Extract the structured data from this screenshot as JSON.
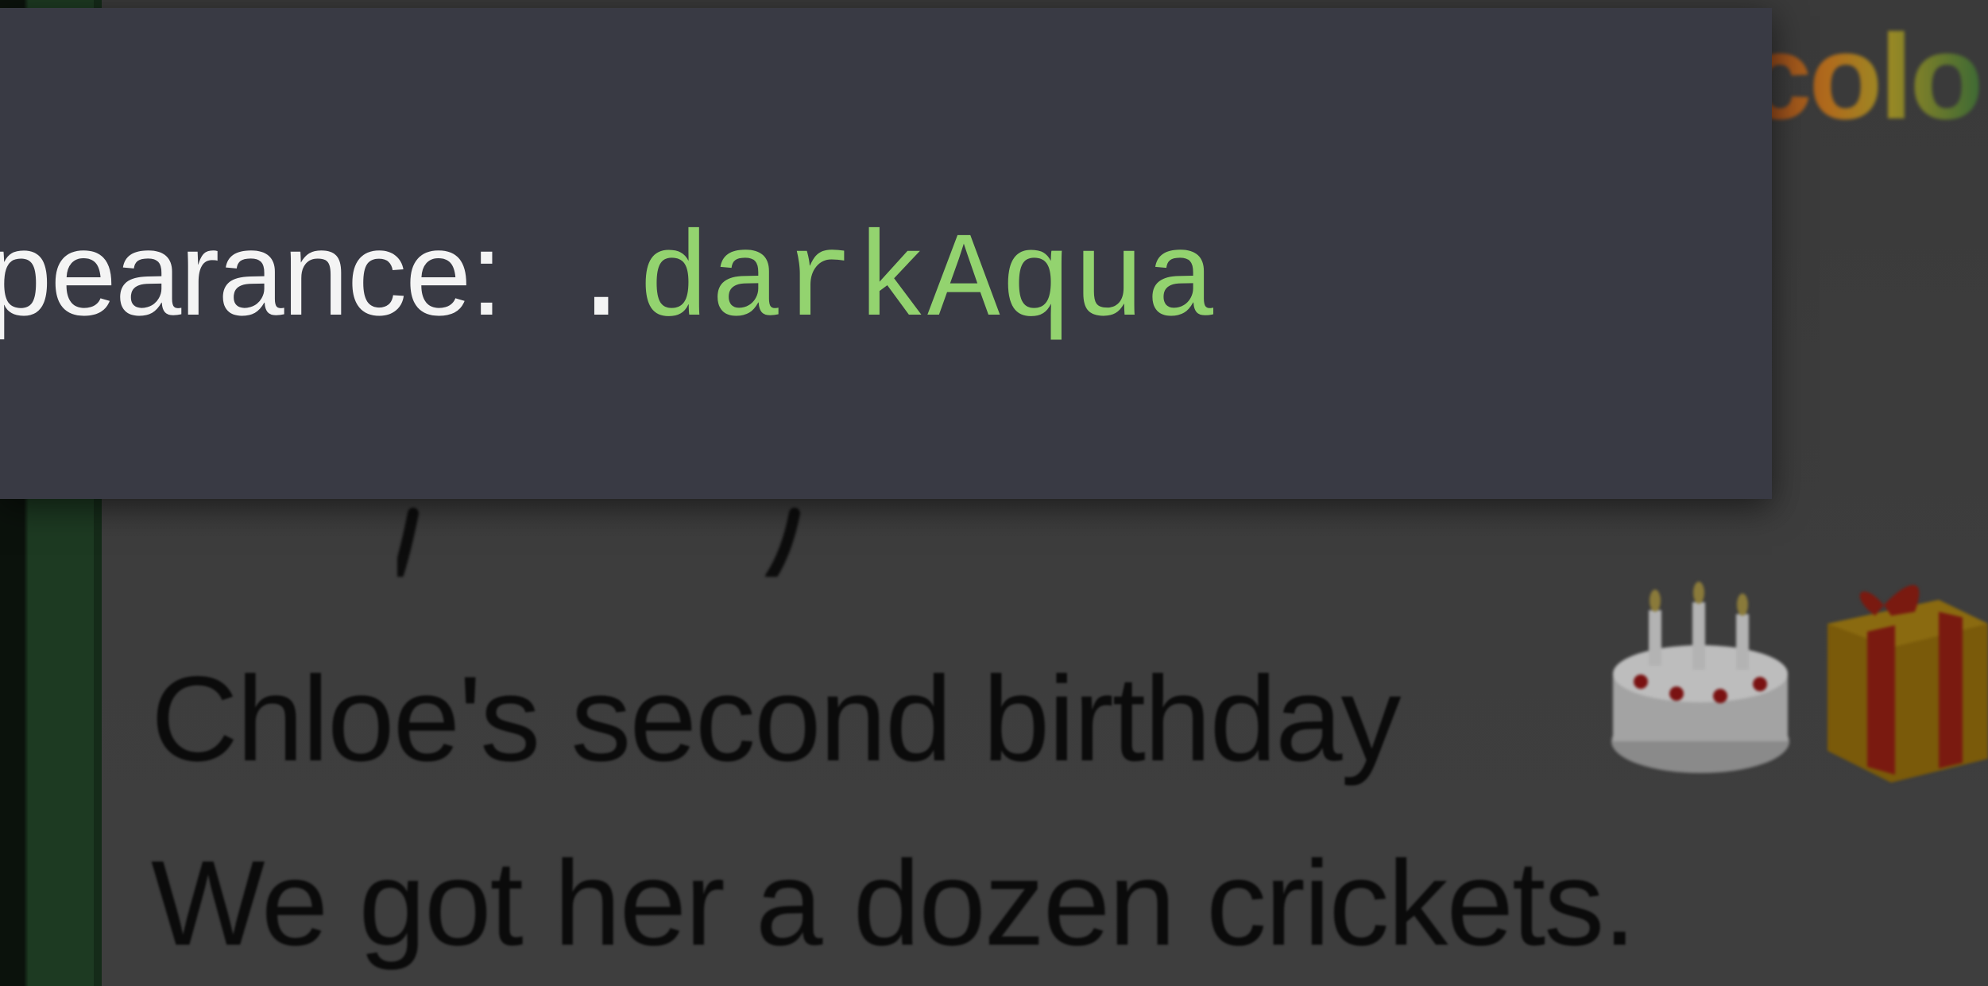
{
  "code_overlay": {
    "label": "pearance:",
    "dot": ".",
    "value": "darkAqua"
  },
  "note": {
    "partial_heading": "colo",
    "lines": [
      "Chloe's second birthday",
      "We got her a dozen crickets."
    ],
    "emoji": [
      "birthday-cake",
      "wrapped-gift"
    ]
  },
  "colors": {
    "code_panel_bg": "#393a44",
    "code_value": "#93d36f",
    "code_text": "#f4f4f4",
    "sidebar_green": "#1d3a22",
    "dimmed_background": "#3b3b3b"
  }
}
